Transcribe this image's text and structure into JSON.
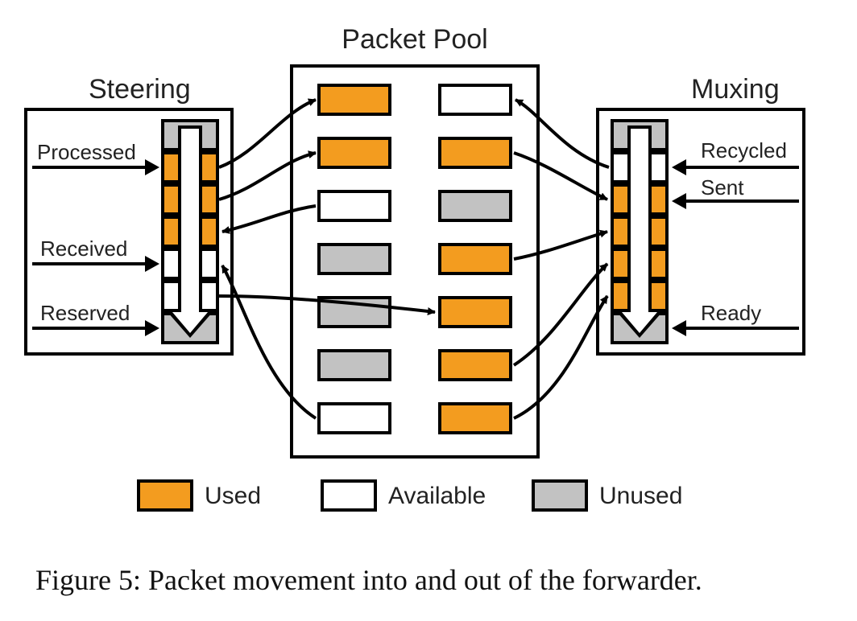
{
  "caption": "Figure 5: Packet movement into and out of the forwarder.",
  "colors": {
    "used": "#f39c1f",
    "available": "#ffffff",
    "unused": "#c2c2c2"
  },
  "legend": {
    "used": "Used",
    "available": "Available",
    "unused": "Unused"
  },
  "pool": {
    "title": "Packet Pool",
    "left_column": [
      "used",
      "used",
      "available",
      "unused",
      "unused",
      "unused",
      "available"
    ],
    "right_column": [
      "available",
      "used",
      "unused",
      "used",
      "used",
      "used",
      "used"
    ]
  },
  "steering": {
    "title": "Steering",
    "labels": {
      "processed": "Processed",
      "received": "Received",
      "reserved": "Reserved"
    },
    "slots_top_to_bottom": [
      "unused",
      "used",
      "used",
      "used",
      "available",
      "available",
      "unused"
    ]
  },
  "muxing": {
    "title": "Muxing",
    "labels": {
      "recycled": "Recycled",
      "sent": "Sent",
      "ready": "Ready"
    },
    "slots_top_to_bottom": [
      "unused",
      "available",
      "used",
      "used",
      "used",
      "used",
      "unused"
    ]
  },
  "curved_arrows_description": {
    "note": "Directional packet-movement arrows drawn between the Steering queue, the Packet Pool, and the Muxing queue.",
    "steering_to_pool_left_column": [
      {
        "from": "steering slot 2 (used)",
        "to": "pool left row 1 (used)"
      },
      {
        "from": "steering slot 3 (used)",
        "to": "pool left row 2 (used)"
      },
      {
        "from": "pool left row 3 (available)",
        "to": "steering slot 4 (used)"
      },
      {
        "from": "pool left row 7 (available)",
        "to": "steering slot 5 (available)"
      },
      {
        "from": "steering slot 6 (available)",
        "to": "pool right row 5 (used)"
      }
    ],
    "muxing_to_pool_right_column": [
      {
        "from": "muxing slot 2 (available)",
        "to": "pool right row 1 (available)"
      },
      {
        "from": "pool right row 2 (used)",
        "to": "muxing slot 3 (used)"
      },
      {
        "from": "pool right row 4 (used)",
        "to": "muxing slot 4 (used)"
      },
      {
        "from": "pool right row 6 (used)",
        "to": "muxing slot 5 (used)"
      },
      {
        "from": "pool right row 7 (used)",
        "to": "muxing slot 6 (used)"
      }
    ]
  }
}
